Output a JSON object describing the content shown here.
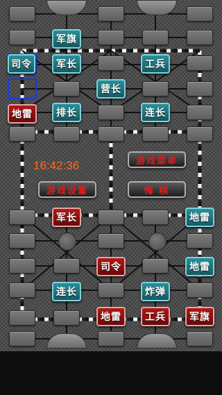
{
  "timer": "16:42:36",
  "menu": {
    "game_menu": "游戏菜单",
    "game_settings": "游戏设置",
    "regret": "悔 棋"
  },
  "pieces": [
    {
      "label": "军旗",
      "side": "blue"
    },
    {
      "label": "司令",
      "side": "blue"
    },
    {
      "label": "军长",
      "side": "blue"
    },
    {
      "label": "工兵",
      "side": "blue"
    },
    {
      "label": "营长",
      "side": "blue"
    },
    {
      "label": "地雷",
      "side": "red"
    },
    {
      "label": "排长",
      "side": "blue"
    },
    {
      "label": "连长",
      "side": "blue"
    },
    {
      "label": "军长",
      "side": "red"
    },
    {
      "label": "地雷",
      "side": "blue"
    },
    {
      "label": "司令",
      "side": "red"
    },
    {
      "label": "地雷",
      "side": "blue"
    },
    {
      "label": "连长",
      "side": "blue"
    },
    {
      "label": "炸弹",
      "side": "blue"
    },
    {
      "label": "地雷",
      "side": "red"
    },
    {
      "label": "工兵",
      "side": "red"
    },
    {
      "label": "军旗",
      "side": "red"
    }
  ]
}
